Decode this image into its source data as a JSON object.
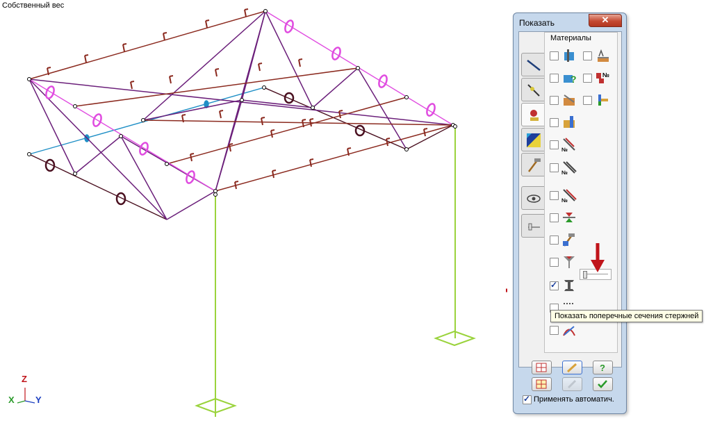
{
  "viewport": {
    "title": "Собственный вес"
  },
  "axes": {
    "z": "Z",
    "x": "X",
    "y": "Y"
  },
  "dialog": {
    "title": "Показать",
    "close_symbol": "✕",
    "group_title": "Материалы",
    "apply_auto_label": "Применять автоматич.",
    "tooltip": "Показать поперечные сечения стержней",
    "slider_value": 0
  },
  "colors": {
    "frame": "#6b1f7a",
    "beam": "#8b2a1f",
    "pink": "#e04ce0",
    "column": "#9ad33c",
    "blue": "#1f8fc6",
    "arrow": "#c0141a"
  }
}
